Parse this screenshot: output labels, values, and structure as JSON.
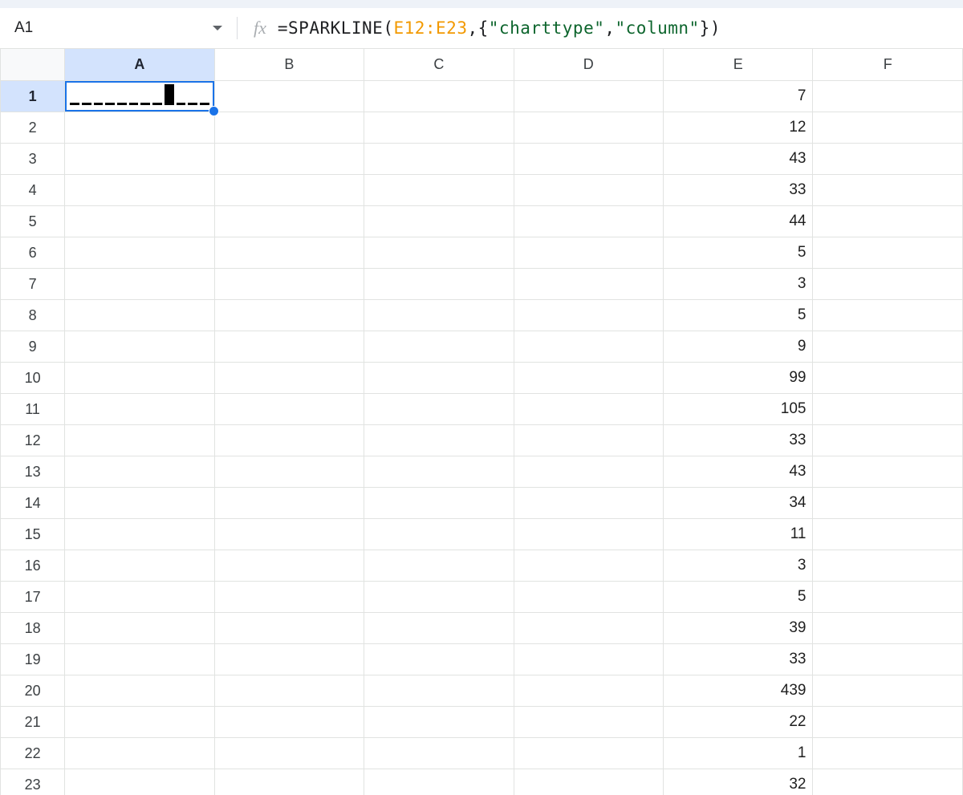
{
  "name_box": {
    "value": "A1"
  },
  "formula": {
    "prefix": "=SPARKLINE(",
    "range": "E12:E23",
    "mid1": ",{",
    "kw1": "\"charttype\"",
    "mid2": ",",
    "kw2": "\"column\"",
    "suffix": "})",
    "plain": "=SPARKLINE(E12:E23,{\"charttype\",\"column\"})"
  },
  "columns": [
    "A",
    "B",
    "C",
    "D",
    "E",
    "F"
  ],
  "active_col_index": 0,
  "active_row_index": 0,
  "selected_cell": "A1",
  "rows_count": 23,
  "values_column": "E",
  "values": {
    "E1": 7,
    "E2": 12,
    "E3": 43,
    "E4": 33,
    "E5": 44,
    "E6": 5,
    "E7": 3,
    "E8": 5,
    "E9": 9,
    "E10": 99,
    "E11": 105,
    "E12": 33,
    "E13": 43,
    "E14": 34,
    "E15": 11,
    "E16": 3,
    "E17": 5,
    "E18": 39,
    "E19": 33,
    "E20": 439,
    "E21": 22,
    "E22": 1,
    "E23": 32
  },
  "chart_data": {
    "type": "bar",
    "title": "Sparkline column chart of E12:E23",
    "xlabel": "",
    "ylabel": "",
    "categories": [
      "E12",
      "E13",
      "E14",
      "E15",
      "E16",
      "E17",
      "E18",
      "E19",
      "E20",
      "E21",
      "E22",
      "E23"
    ],
    "values": [
      33,
      43,
      34,
      11,
      3,
      5,
      39,
      33,
      439,
      22,
      1,
      32
    ],
    "ylim": [
      0,
      439
    ]
  }
}
